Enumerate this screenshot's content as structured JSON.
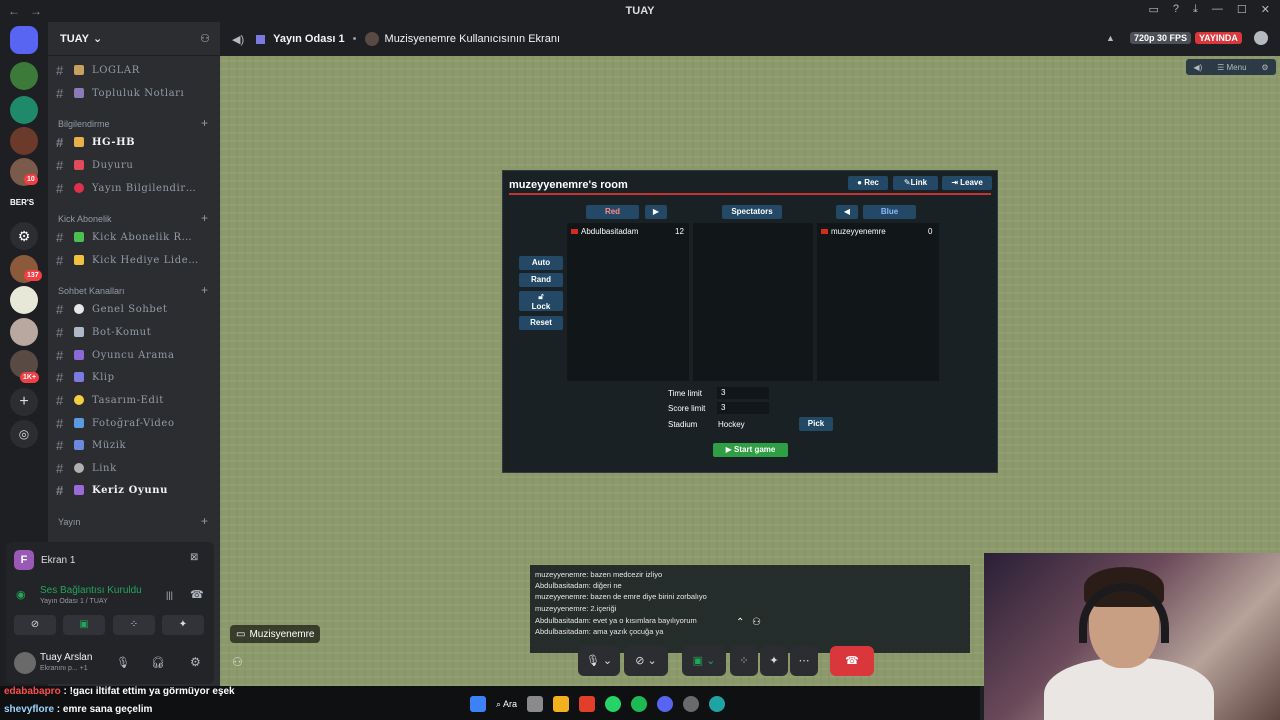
{
  "window": {
    "title": "TUAY",
    "back": "←",
    "forward": "→"
  },
  "rail": {
    "badges": [
      "10",
      "137",
      "1K+"
    ],
    "text_logo": "BER'S"
  },
  "server": {
    "name": "TUAY"
  },
  "channels": [
    {
      "label": "LOGLAR",
      "bright": false
    },
    {
      "label": "Topluluk  Notları",
      "bright": false
    }
  ],
  "categories": {
    "bilgilendirme": "Bilgilendirme",
    "kick": "Kick Abonelik",
    "sohbet": "Sohbet Kanalları",
    "yayin": "Yayın"
  },
  "bilgilendirme_channels": [
    {
      "label": "HG-HB",
      "bright": true
    },
    {
      "label": "Duyuru",
      "bright": false
    },
    {
      "label": "Yayın  Bilgilendir…",
      "bright": false
    }
  ],
  "kick_channels": [
    {
      "label": "Kick  Abonelik  R…",
      "bright": false
    },
    {
      "label": "Kick  Hediye  Lide…",
      "bright": false
    }
  ],
  "sohbet_channels": [
    {
      "label": "Genel  Sohbet",
      "bright": false
    },
    {
      "label": "Bot-Komut",
      "bright": false
    },
    {
      "label": "Oyuncu  Arama",
      "bright": false
    },
    {
      "label": "Klip",
      "bright": false
    },
    {
      "label": "Tasarım-Edit",
      "bright": false
    },
    {
      "label": "Fotoğraf-Video",
      "bright": false
    },
    {
      "label": "Müzik",
      "bright": false
    },
    {
      "label": "Link",
      "bright": false
    },
    {
      "label": "Keriz  Oyunu",
      "bright": true
    }
  ],
  "panel": {
    "screen_label": "Ekran 1",
    "screen_letter": "F",
    "voice_status": "Ses Bağlantısı Kuruldu",
    "voice_sub": "Yayın Odası 1 / TUAY",
    "user_name": "Tuay Arslan",
    "user_sub": "Ekranını p... +1"
  },
  "stream_header": {
    "room": "Yayın Odası 1",
    "sep": "•",
    "screen": "Muzisyenemre Kullanıcısının Ekranı",
    "quality": "720p 30 FPS",
    "live": "YAYINDA",
    "menu": "Menu"
  },
  "room": {
    "title": "muzeyyenemre's room",
    "rec": "Rec",
    "link": "Link",
    "leave": "Leave",
    "red": "Red",
    "spectators": "Spectators",
    "blue": "Blue",
    "auto": "Auto",
    "rand": "Rand",
    "lock": "Lock",
    "reset": "Reset",
    "red_players": [
      {
        "name": "Abdulbasitadam",
        "score": "12"
      }
    ],
    "blue_players": [
      {
        "name": "muzeyyenemre",
        "score": "0"
      }
    ],
    "time_limit_label": "Time limit",
    "time_limit": "3",
    "score_limit_label": "Score limit",
    "score_limit": "3",
    "stadium_label": "Stadium",
    "stadium": "Hockey",
    "pick": "Pick",
    "start": "▶ Start game"
  },
  "game_chat": [
    "muzeyyenemre: bazen medcezir izliyo",
    "Abdulbasitadam: diğeri ne",
    "muzeyyenemre: bazen de emre diye birini zorbalıyo",
    "muzeyyenemre: 2.içeriği",
    "Abdulbasitadam: evet ya o kısımlara bayılıyorum",
    "Abdulbasitadam: ama yazık çocuğa ya"
  ],
  "stream_label": "Muzisyenemre",
  "bottom_chat": [
    {
      "user": "edababapro",
      "user_color": "#ff4d4d",
      "text": " : !gacı iltifat ettim ya görmüyor eşek"
    },
    {
      "user": "shevyflore",
      "user_color": "#9bd5ff",
      "text": " : emre sana geçelim"
    }
  ],
  "taskbar": {
    "search": "Ara"
  },
  "colors": {
    "accent": "#5865f2",
    "live_red": "#da373c",
    "online_green": "#23a55a",
    "hangup": "#da373c"
  }
}
